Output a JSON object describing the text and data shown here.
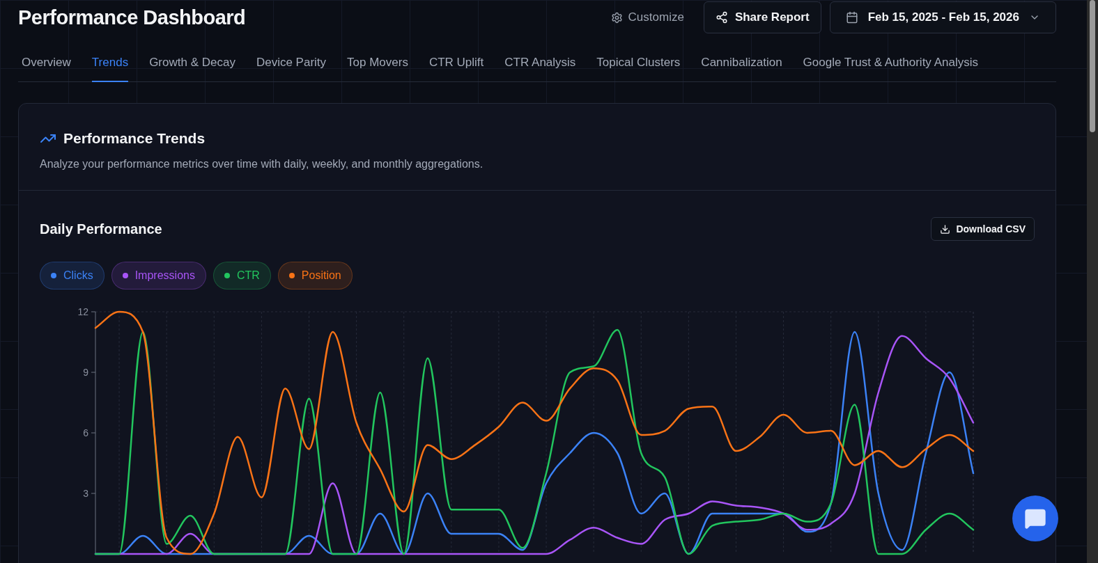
{
  "header": {
    "title": "Performance Dashboard",
    "customize": "Customize",
    "share": "Share Report",
    "date_range": "Feb 15, 2025 - Feb 15, 2026"
  },
  "tabs": [
    {
      "label": "Overview",
      "selected": false
    },
    {
      "label": "Trends",
      "selected": true
    },
    {
      "label": "Growth & Decay",
      "selected": false
    },
    {
      "label": "Device Parity",
      "selected": false
    },
    {
      "label": "Top Movers",
      "selected": false
    },
    {
      "label": "CTR Uplift",
      "selected": false
    },
    {
      "label": "CTR Analysis",
      "selected": false
    },
    {
      "label": "Topical Clusters",
      "selected": false
    },
    {
      "label": "Cannibalization",
      "selected": false
    },
    {
      "label": "Google Trust & Authority Analysis",
      "selected": false
    }
  ],
  "card": {
    "title": "Performance Trends",
    "description": "Analyze your performance metrics over time with daily, weekly, and monthly aggregations."
  },
  "section": {
    "title": "Daily Performance",
    "download": "Download CSV"
  },
  "chart_data": {
    "type": "line",
    "grid": true,
    "ylim": [
      0,
      12
    ],
    "yticks": [
      3,
      6,
      9,
      12
    ],
    "series": [
      {
        "name": "Clicks",
        "color": "#3b82f6",
        "values": [
          0,
          0,
          0.9,
          0,
          0,
          0,
          0,
          0,
          0,
          0.9,
          0,
          0,
          2,
          0,
          3,
          1,
          1,
          1,
          0.2,
          3.5,
          5,
          6,
          5,
          2,
          3,
          0,
          2,
          2,
          2,
          2,
          1.1,
          2.5,
          11,
          3,
          0.2,
          5,
          9,
          4
        ]
      },
      {
        "name": "Impressions",
        "color": "#a855f7",
        "values": [
          0,
          0,
          0,
          0,
          1,
          0,
          0,
          0,
          0,
          0,
          3.5,
          0,
          0,
          0,
          0,
          0,
          0,
          0,
          0,
          0,
          0.7,
          1.3,
          0.8,
          0.5,
          1.7,
          2,
          2.6,
          2.4,
          2.3,
          2,
          1.2,
          1.5,
          3,
          8,
          10.8,
          9.7,
          8.7,
          6.5
        ]
      },
      {
        "name": "CTR",
        "color": "#22c55e",
        "values": [
          0,
          0,
          11,
          0.5,
          1.9,
          0,
          0,
          0,
          0,
          7.7,
          0,
          0,
          8,
          0,
          9.7,
          2.2,
          2.2,
          2.2,
          0.3,
          4,
          9,
          9.3,
          11.1,
          5,
          3.8,
          0,
          1.4,
          1.6,
          1.7,
          2,
          1.6,
          2.5,
          7.4,
          0,
          0,
          1.2,
          2,
          1.2
        ]
      },
      {
        "name": "Position",
        "color": "#f97316",
        "values": [
          11.2,
          12,
          11,
          0.8,
          0,
          2,
          5.8,
          2.8,
          8.2,
          5.2,
          11,
          6.5,
          4.2,
          2.1,
          5.4,
          4.7,
          5.4,
          6.3,
          7.5,
          6.6,
          8.2,
          9.2,
          8.6,
          5.9,
          6.1,
          7.2,
          7.3,
          5.1,
          5.8,
          6.9,
          6,
          6.1,
          4.4,
          5.1,
          4.3,
          5.2,
          5.9,
          5.1
        ]
      }
    ]
  }
}
